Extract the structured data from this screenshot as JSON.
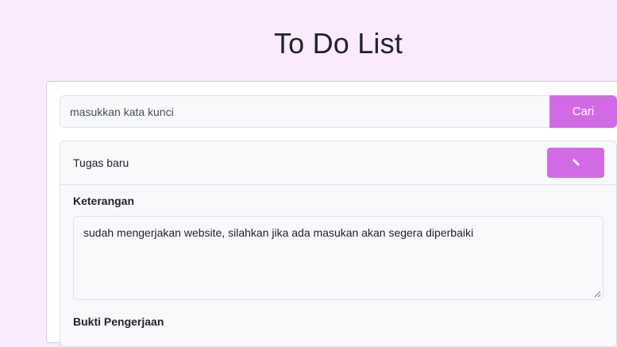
{
  "page": {
    "title": "To Do List"
  },
  "search": {
    "placeholder": "masukkan kata kunci",
    "button_label": "Cari"
  },
  "task": {
    "title": "Tugas baru",
    "edit_icon": "pencil-icon",
    "description_label": "Keterangan",
    "description_value": "sudah mengerjakan website, silahkan jika ada masukan akan segera diperbaiki",
    "proof_label": "Bukti Pengerjaan"
  },
  "colors": {
    "background": "#fbe9fd",
    "accent": "#d26ae6",
    "card": "#ffffff",
    "panel": "#f8f9fb"
  }
}
